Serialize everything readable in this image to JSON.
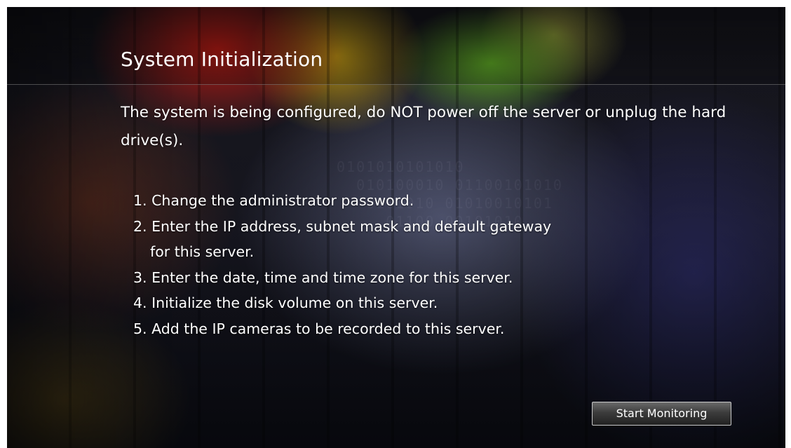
{
  "screen": {
    "title": "System Initialization",
    "description": "The system is being configured, do NOT power off the server or unplug the hard drive(s).",
    "steps": [
      {
        "text": "1. Change the administrator password.",
        "continuation": ""
      },
      {
        "text": "2. Enter the IP address, subnet mask and default gateway",
        "continuation": "for this server."
      },
      {
        "text": "3. Enter the date, time and time zone for this server.",
        "continuation": ""
      },
      {
        "text": "4. Initialize the disk volume on this server.",
        "continuation": ""
      },
      {
        "text": "5. Add the IP cameras to be recorded to this server.",
        "continuation": ""
      }
    ],
    "start_button_label": "Start Monitoring"
  },
  "colors": {
    "text": "#ffffff",
    "button_bg": "#3c3c3c",
    "button_border": "#c8c8c8"
  }
}
